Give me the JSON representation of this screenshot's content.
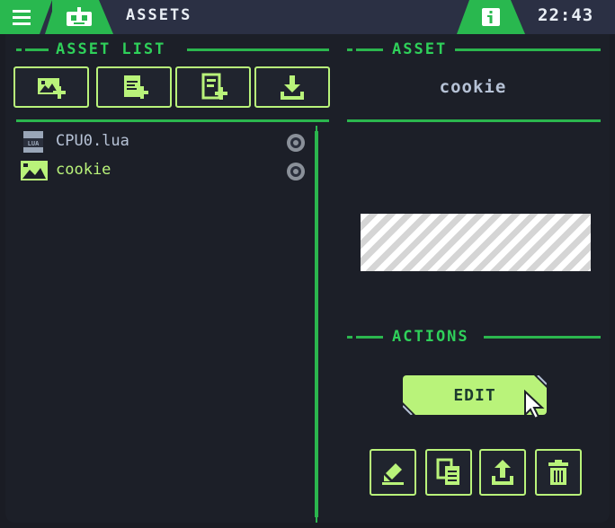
{
  "topbar": {
    "title": "ASSETS",
    "clock": "22:43",
    "menu_icon": "hamburger-icon",
    "app_icon": "robot-icon",
    "info_icon": "info-icon"
  },
  "asset_list": {
    "header": "ASSET LIST",
    "toolbar": [
      {
        "icon": "add-image-icon"
      },
      {
        "icon": "add-code-icon"
      },
      {
        "icon": "add-file-icon"
      },
      {
        "icon": "import-icon"
      }
    ],
    "items": [
      {
        "name": "CPU0.lua",
        "icon": "lua-file-icon",
        "selected": false
      },
      {
        "name": "cookie",
        "icon": "image-icon",
        "selected": true
      }
    ]
  },
  "asset_panel": {
    "header": "ASSET",
    "name": "cookie"
  },
  "actions": {
    "header": "ACTIONS",
    "edit_label": "EDIT",
    "buttons": [
      {
        "icon": "rename-icon"
      },
      {
        "icon": "duplicate-icon"
      },
      {
        "icon": "export-icon"
      },
      {
        "icon": "trash-icon"
      }
    ]
  },
  "colors": {
    "accent": "#29b84f",
    "lime": "#b9f37a",
    "background": "#1c1f28",
    "topbar": "#2b3044"
  }
}
